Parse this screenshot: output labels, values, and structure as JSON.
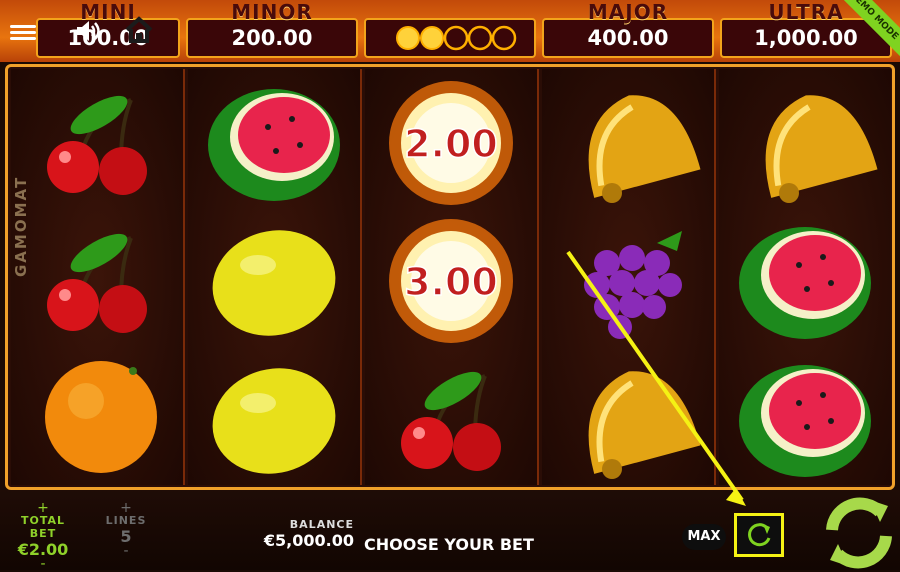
{
  "jackpots": [
    {
      "label": "MINI",
      "value": "100.00"
    },
    {
      "label": "MINOR",
      "value": "200.00"
    },
    {
      "label": "MAJOR",
      "value": "400.00"
    },
    {
      "label": "ULTRA",
      "value": "1,000.00"
    }
  ],
  "demo_badge": "DEMO MODE",
  "brand": "GAMOMAT",
  "reels": [
    [
      "cherry",
      "cherry",
      "orange"
    ],
    [
      "watermelon",
      "lemon",
      "lemon"
    ],
    [
      "coin",
      "coin",
      "cherry"
    ],
    [
      "bell",
      "grapes",
      "bell"
    ],
    [
      "bell",
      "watermelon",
      "watermelon"
    ]
  ],
  "coins": [
    "2.00",
    "3.00"
  ],
  "bottom": {
    "total_bet_label": "TOTAL BET",
    "total_bet_value": "€2.00",
    "lines_label": "LINES",
    "lines_value": "5",
    "balance_label": "BALANCE",
    "balance_value": "€5,000.00",
    "choose_bet": "CHOOSE YOUR BET",
    "max_label": "MAX",
    "plus": "+",
    "minus": "-"
  },
  "colors": {
    "accent": "#f0a12a",
    "bet_green": "#8fd12a",
    "highlight": "#f5f214"
  }
}
